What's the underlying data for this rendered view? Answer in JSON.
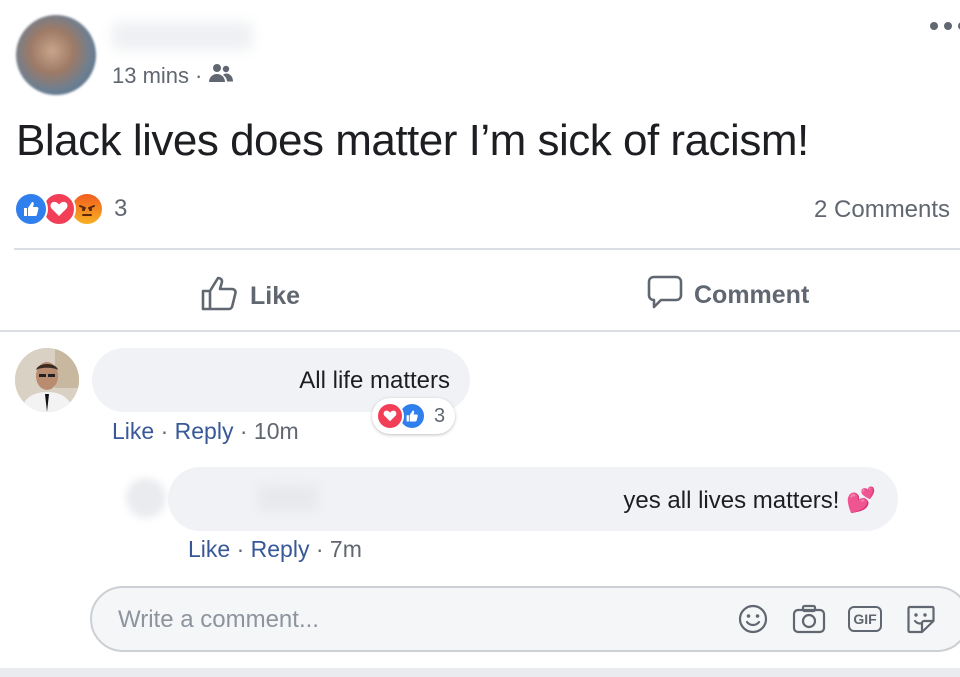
{
  "post": {
    "time": "13 mins",
    "separator": "·",
    "audience_icon": "friends-icon",
    "text": "Black lives does matter I’m sick of racism!",
    "reactions": [
      "like",
      "love",
      "angry"
    ],
    "reaction_count": "3",
    "comments_count": "2 Comments"
  },
  "actions": {
    "like_label": "Like",
    "comment_label": "Comment"
  },
  "comments": [
    {
      "text": "All life matters",
      "like": "Like",
      "reply": "Reply",
      "time": "10m",
      "reactions": [
        "love",
        "like"
      ],
      "reaction_count": "3"
    },
    {
      "text": "yes all lives matters! 💕",
      "like": "Like",
      "reply": "Reply",
      "time": "7m"
    }
  ],
  "composer": {
    "placeholder": "Write a comment...",
    "icons": [
      "emoji-icon",
      "camera-icon",
      "gif-icon",
      "sticker-icon"
    ],
    "gif_label": "GIF"
  },
  "colors": {
    "link": "#385898",
    "like_blue": "#2f80ed",
    "love_red": "#f33e58",
    "muted": "#606770"
  }
}
